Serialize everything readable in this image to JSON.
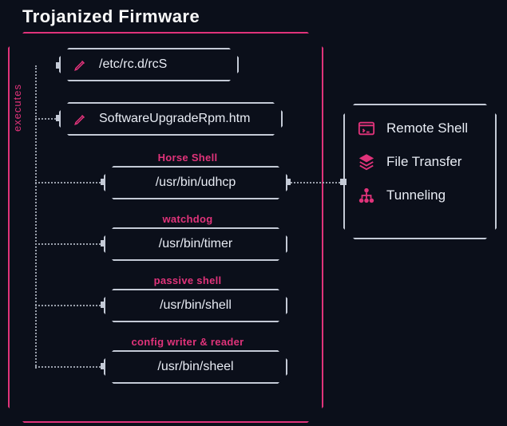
{
  "title": "Trojanized Firmware",
  "executes_label": "executes",
  "cards": [
    {
      "label": "/etc/rc.d/rcS",
      "subtitle": ""
    },
    {
      "label": "SoftwareUpgradeRpm.htm",
      "subtitle": ""
    },
    {
      "label": "/usr/bin/udhcp",
      "subtitle": "Horse Shell"
    },
    {
      "label": "/usr/bin/timer",
      "subtitle": "watchdog"
    },
    {
      "label": "/usr/bin/shell",
      "subtitle": "passive shell"
    },
    {
      "label": "/usr/bin/sheel",
      "subtitle": "config writer & reader"
    }
  ],
  "capabilities": [
    {
      "label": "Remote Shell"
    },
    {
      "label": "File Transfer"
    },
    {
      "label": "Tunneling"
    }
  ]
}
